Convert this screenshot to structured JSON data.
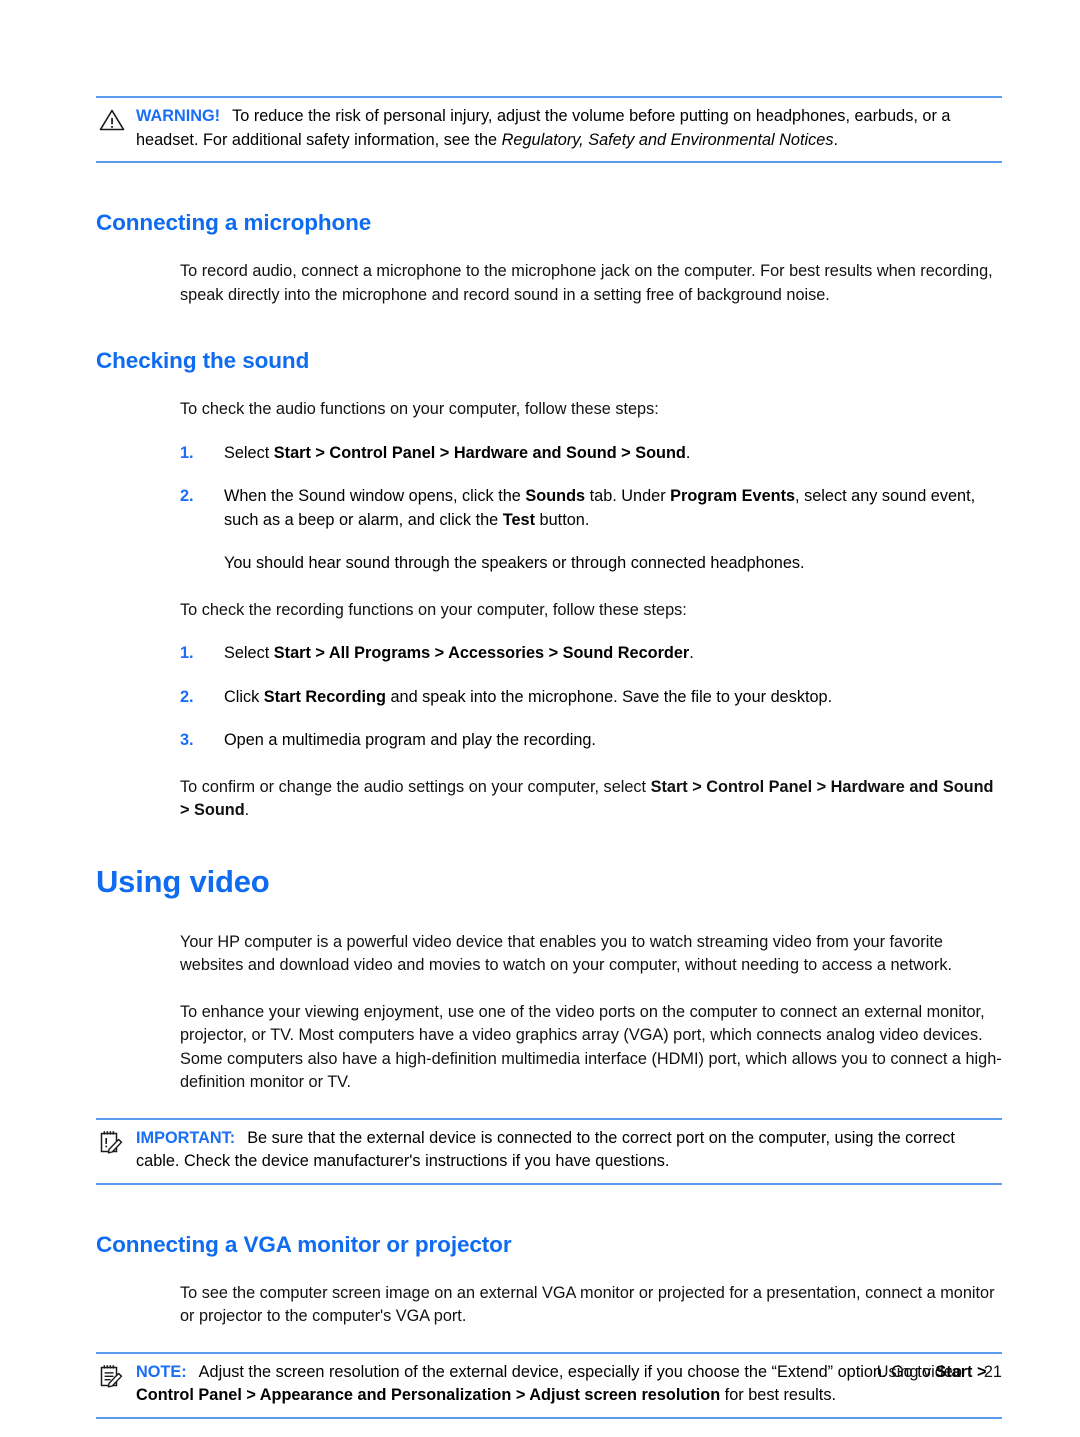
{
  "document": {
    "page_label": "Using video",
    "page_number": "21"
  },
  "warning_box": {
    "icon": "warning-triangle-icon",
    "label": "WARNING!",
    "text_1": "To reduce the risk of personal injury, adjust the volume before putting on headphones, earbuds, or a headset. For additional safety information, see the ",
    "italic_1": "Regulatory, Safety and Environmental Notices",
    "text_2": "."
  },
  "section_microphone": {
    "heading": "Connecting a microphone",
    "paragraph": "To record audio, connect a microphone to the microphone jack on the computer. For best results when recording, speak directly into the microphone and record sound in a setting free of background noise."
  },
  "section_checking_sound": {
    "heading": "Checking the sound",
    "intro_audio": "To check the audio functions on your computer, follow these steps:",
    "steps_audio": [
      {
        "num": "1.",
        "parts": [
          {
            "text": "Select ",
            "bold": false
          },
          {
            "text": "Start > Control Panel > Hardware and Sound > Sound",
            "bold": true
          },
          {
            "text": ".",
            "bold": false
          }
        ]
      },
      {
        "num": "2.",
        "parts": [
          {
            "text": "When the Sound window opens, click the ",
            "bold": false
          },
          {
            "text": "Sounds",
            "bold": true
          },
          {
            "text": " tab. Under ",
            "bold": false
          },
          {
            "text": "Program Events",
            "bold": true
          },
          {
            "text": ", select any sound event, such as a beep or alarm, and click the ",
            "bold": false
          },
          {
            "text": "Test",
            "bold": true
          },
          {
            "text": " button.",
            "bold": false
          }
        ],
        "sub_paragraph": "You should hear sound through the speakers or through connected headphones."
      }
    ],
    "intro_recording": "To check the recording functions on your computer, follow these steps:",
    "steps_recording": [
      {
        "num": "1.",
        "parts": [
          {
            "text": "Select ",
            "bold": false
          },
          {
            "text": "Start > All Programs > Accessories > Sound Recorder",
            "bold": true
          },
          {
            "text": ".",
            "bold": false
          }
        ]
      },
      {
        "num": "2.",
        "parts": [
          {
            "text": "Click ",
            "bold": false
          },
          {
            "text": "Start Recording",
            "bold": true
          },
          {
            "text": " and speak into the microphone. Save the file to your desktop.",
            "bold": false
          }
        ]
      },
      {
        "num": "3.",
        "parts": [
          {
            "text": "Open a multimedia program and play the recording.",
            "bold": false
          }
        ]
      }
    ],
    "closing_parts": [
      {
        "text": "To confirm or change the audio settings on your computer, select ",
        "bold": false
      },
      {
        "text": "Start > Control Panel > Hardware and Sound > Sound",
        "bold": true
      },
      {
        "text": ".",
        "bold": false
      }
    ]
  },
  "section_using_video": {
    "heading": "Using video",
    "paragraph_1": "Your HP computer is a powerful video device that enables you to watch streaming video from your favorite websites and download video and movies to watch on your computer, without needing to access a network.",
    "paragraph_2": "To enhance your viewing enjoyment, use one of the video ports on the computer to connect an external monitor, projector, or TV. Most computers have a video graphics array (VGA) port, which connects analog video devices. Some computers also have a high-definition multimedia interface (HDMI) port, which allows you to connect a high-definition monitor or TV."
  },
  "important_box": {
    "icon": "notepad-pencil-icon",
    "label": "IMPORTANT:",
    "text": "Be sure that the external device is connected to the correct port on the computer, using the correct cable. Check the device manufacturer's instructions if you have questions."
  },
  "section_vga": {
    "heading": "Connecting a VGA monitor or projector",
    "paragraph": "To see the computer screen image on an external VGA monitor or projected for a presentation, connect a monitor or projector to the computer's VGA port."
  },
  "note_box": {
    "icon": "notepad-pencil-icon",
    "label": "NOTE:",
    "parts": [
      {
        "text": "Adjust the screen resolution of the external device, especially if you choose the “Extend” option. Go to ",
        "bold": false
      },
      {
        "text": "Start > Control Panel > Appearance and Personalization > Adjust screen resolution",
        "bold": true
      },
      {
        "text": " for best results.",
        "bold": false
      }
    ]
  },
  "colors": {
    "heading_blue": "#0f6bf0",
    "accent_blue": "#1a6ef5",
    "rule_blue": "#5b9bf0",
    "body_black": "#111111"
  }
}
